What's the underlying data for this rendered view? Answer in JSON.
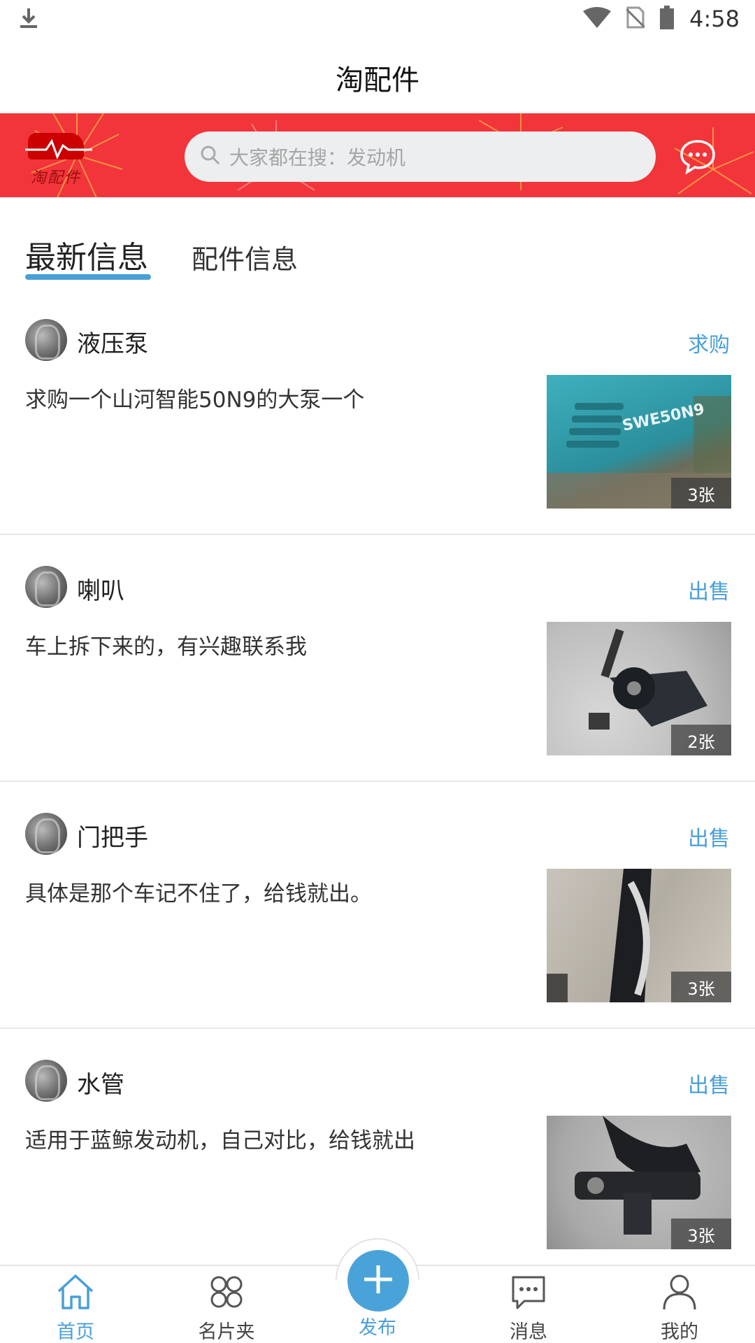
{
  "status_bar": {
    "time": "4:58"
  },
  "header": {
    "title": "淘配件"
  },
  "banner": {
    "logo_text": "淘配件",
    "search_placeholder": "大家都在搜：发动机"
  },
  "tabs": [
    {
      "label": "最新信息",
      "active": true
    },
    {
      "label": "配件信息",
      "active": false
    }
  ],
  "feed": [
    {
      "title": "液压泵",
      "type": "求购",
      "desc": "求购一个山河智能50N9的大泵一个",
      "count": "3张",
      "thumb_label": "SWE50N9"
    },
    {
      "title": "喇叭",
      "type": "出售",
      "desc": "车上拆下来的，有兴趣联系我",
      "count": "2张"
    },
    {
      "title": "门把手",
      "type": "出售",
      "desc": "具体是那个车记不住了，给钱就出。",
      "count": "3张"
    },
    {
      "title": "水管",
      "type": "出售",
      "desc": "适用于蓝鲸发动机，自己对比，给钱就出",
      "count": "3张"
    }
  ],
  "bottom_nav": [
    {
      "label": "首页",
      "icon": "home-icon",
      "active": true
    },
    {
      "label": "名片夹",
      "icon": "card-holder-icon",
      "active": false
    },
    {
      "label": "发布",
      "icon": "plus-icon",
      "active": false
    },
    {
      "label": "消息",
      "icon": "message-icon",
      "active": false
    },
    {
      "label": "我的",
      "icon": "user-icon",
      "active": false
    }
  ],
  "colors": {
    "accent": "#4a9fd6",
    "banner_red": "#f2353a"
  }
}
